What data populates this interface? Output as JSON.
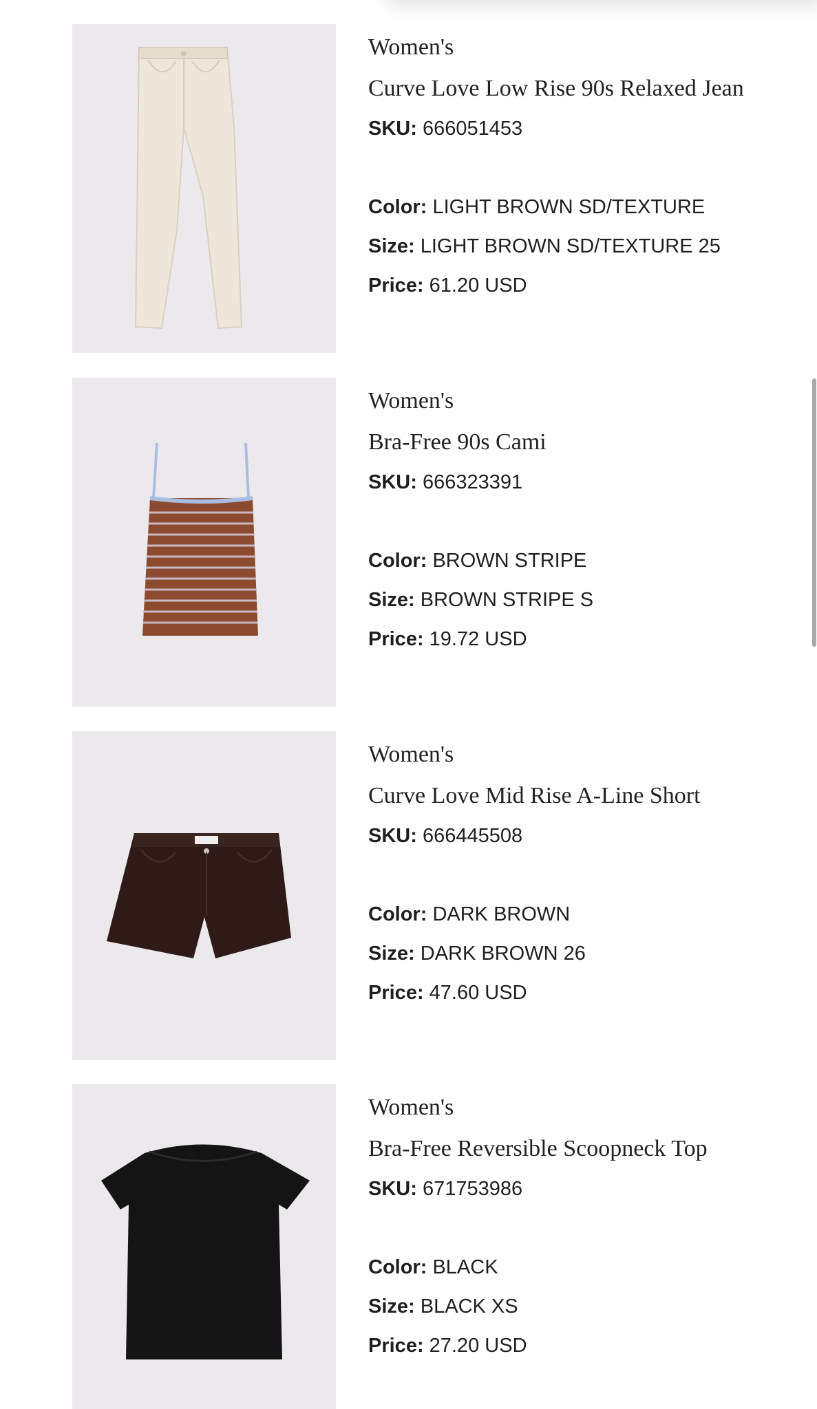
{
  "orders": [
    {
      "category": "Women's",
      "name": "Curve Love Low Rise 90s Relaxed Jean",
      "sku_label": "SKU:",
      "sku": "666051453",
      "color_label": "Color:",
      "color": "LIGHT BROWN SD/TEXTURE",
      "size_label": "Size:",
      "size": "LIGHT BROWN SD/TEXTURE 25",
      "price_label": "Price:",
      "price": "61.20 USD",
      "image_icon": "jeans-image",
      "image_color": "#eee6da"
    },
    {
      "category": "Women's",
      "name": "Bra-Free 90s Cami",
      "sku_label": "SKU:",
      "sku": "666323391",
      "color_label": "Color:",
      "color": "BROWN STRIPE",
      "size_label": "Size:",
      "size": "BROWN STRIPE S",
      "price_label": "Price:",
      "price": "19.72 USD",
      "image_icon": "cami-image",
      "image_color": "#8c4a2f"
    },
    {
      "category": "Women's",
      "name": "Curve Love Mid Rise A-Line Short",
      "sku_label": "SKU:",
      "sku": "666445508",
      "color_label": "Color:",
      "color": "DARK BROWN",
      "size_label": "Size:",
      "size": "DARK BROWN 26",
      "price_label": "Price:",
      "price": "47.60 USD",
      "image_icon": "shorts-image",
      "image_color": "#2e1a17"
    },
    {
      "category": "Women's",
      "name": "Bra-Free Reversible Scoopneck Top",
      "sku_label": "SKU:",
      "sku": "671753986",
      "color_label": "Color:",
      "color": "BLACK",
      "size_label": "Size:",
      "size": "BLACK XS",
      "price_label": "Price:",
      "price": "27.20 USD",
      "image_icon": "top-image",
      "image_color": "#141414"
    }
  ]
}
